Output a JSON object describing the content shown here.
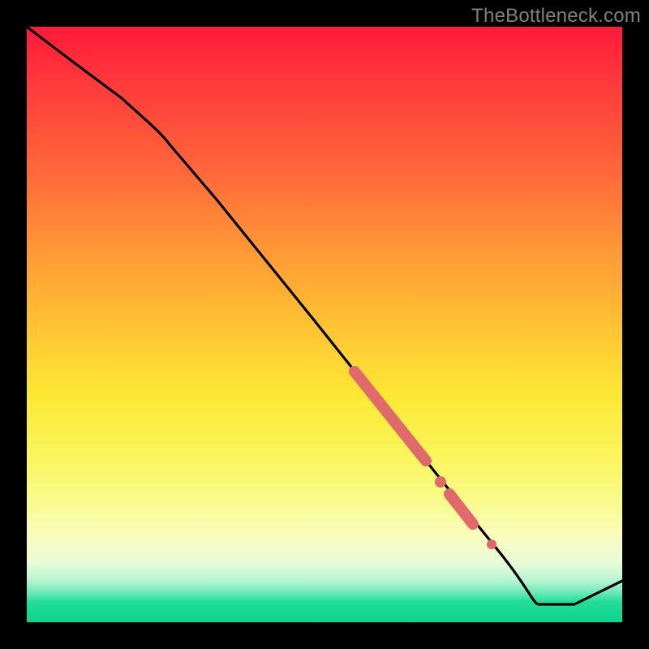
{
  "watermark": "TheBottleneck.com",
  "chart_data": {
    "type": "line",
    "title": "",
    "xlabel": "",
    "ylabel": "",
    "xlim": [
      0,
      100
    ],
    "ylim": [
      0,
      100
    ],
    "grid": false,
    "legend": false,
    "background": "rainbow-gradient-vertical",
    "series": [
      {
        "name": "bottleneck-curve",
        "color": "#000000",
        "x": [
          0,
          8,
          16,
          24,
          32,
          40,
          48,
          56,
          64,
          72,
          80,
          86,
          92,
          100
        ],
        "y": [
          100,
          94,
          88,
          81,
          71,
          61,
          51,
          41,
          31,
          21,
          11,
          3,
          3,
          7
        ]
      }
    ],
    "highlights": [
      {
        "name": "highlight-band-1",
        "color": "#e06a6a",
        "x": [
          55,
          67
        ],
        "y": [
          42,
          27
        ]
      },
      {
        "name": "highlight-dot-1",
        "color": "#e06a6a",
        "x": [
          69.5
        ],
        "y": [
          23.5
        ]
      },
      {
        "name": "highlight-band-2",
        "color": "#e06a6a",
        "x": [
          71,
          75
        ],
        "y": [
          21.5,
          16.5
        ]
      },
      {
        "name": "highlight-dot-2",
        "color": "#e06a6a",
        "x": [
          78
        ],
        "y": [
          13
        ]
      }
    ]
  }
}
